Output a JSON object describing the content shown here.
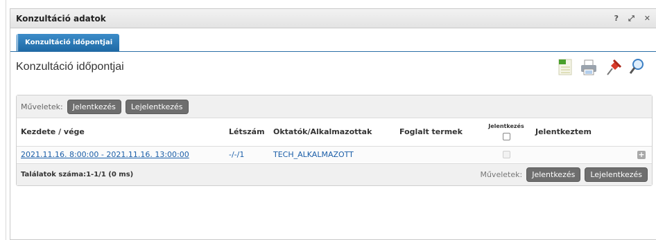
{
  "window": {
    "title": "Konzultáció adatok",
    "help_label": "?",
    "restore_label": "⤢",
    "close_label": "✕"
  },
  "tabs": [
    {
      "label": "Konzultáció időpontjai"
    }
  ],
  "section": {
    "title": "Konzultáció időpontjai"
  },
  "toolbar_icons": [
    "excel-export-icon",
    "print-icon",
    "pin-icon",
    "search-icon"
  ],
  "grid": {
    "operations_label": "Műveletek:",
    "buttons": {
      "register": "Jelentkezés",
      "unregister": "Lejelentkezés"
    },
    "columns": {
      "start_end": "Kezdete / vége",
      "headcount": "Létszám",
      "teachers": "Oktatók/Alkalmazottak",
      "rooms": "Foglalt termek",
      "registration": "Jelentkezés",
      "registered": "Jelentkeztem"
    },
    "rows": [
      {
        "start_end": "2021.11.16. 8:00:00 - 2021.11.16. 13:00:00",
        "headcount": "-/-/1",
        "teachers": "TECH_ALKALMAZOTT",
        "rooms": "",
        "registered": ""
      }
    ],
    "footer": {
      "count": "Találatok száma:1-1/1 (0 ms)",
      "operations_label": "Műveletek:"
    }
  },
  "colors": {
    "tab_accent": "#1f6aa5",
    "button_bg": "#6e6e6e",
    "link": "#1a5ea8"
  }
}
